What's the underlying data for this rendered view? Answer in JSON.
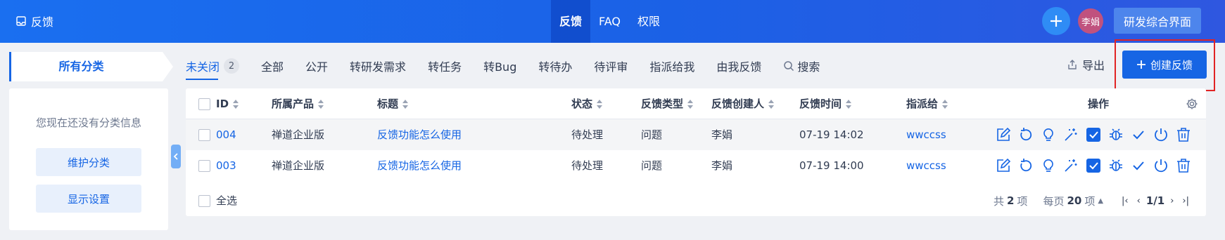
{
  "header": {
    "brand": "反馈",
    "nav": [
      {
        "label": "反馈",
        "active": true
      },
      {
        "label": "FAQ",
        "active": false
      },
      {
        "label": "权限",
        "active": false
      }
    ],
    "avatar_name": "李娟",
    "app_switch": "研发综合界面"
  },
  "sidebar": {
    "tab_label": "所有分类",
    "empty_msg": "您现在还没有分类信息",
    "maintain_btn": "维护分类",
    "display_btn": "显示设置"
  },
  "filters": {
    "tabs": [
      {
        "label": "未关闭",
        "count": "2",
        "active": true
      },
      {
        "label": "全部"
      },
      {
        "label": "公开"
      },
      {
        "label": "转研发需求"
      },
      {
        "label": "转任务"
      },
      {
        "label": "转Bug"
      },
      {
        "label": "转待办"
      },
      {
        "label": "待评审"
      },
      {
        "label": "指派给我"
      },
      {
        "label": "由我反馈"
      }
    ],
    "search_label": "搜索",
    "export_label": "导出",
    "create_label": "创建反馈"
  },
  "table": {
    "headers": {
      "id": "ID",
      "product": "所属产品",
      "title": "标题",
      "status": "状态",
      "type": "反馈类型",
      "creator": "反馈创建人",
      "time": "反馈时间",
      "assignee": "指派给",
      "actions": "操作"
    },
    "rows": [
      {
        "id": "004",
        "product": "禅道企业版",
        "title": "反馈功能怎么使用",
        "status": "待处理",
        "type": "问题",
        "creator": "李娟",
        "time": "07-19 14:02",
        "assignee": "wwccss"
      },
      {
        "id": "003",
        "product": "禅道企业版",
        "title": "反馈功能怎么使用",
        "status": "待处理",
        "type": "问题",
        "creator": "李娟",
        "time": "07-19 14:00",
        "assignee": "wwccss"
      }
    ],
    "select_all": "全选"
  },
  "pager": {
    "total_prefix": "共",
    "total": "2",
    "total_suffix": "项",
    "per_page_prefix": "每页",
    "per_page": "20",
    "per_page_suffix": "项",
    "page": "1/1"
  },
  "colors": {
    "primary": "#1665e4",
    "highlight_border": "#e12424",
    "avatar_bg": "#c0527e"
  }
}
